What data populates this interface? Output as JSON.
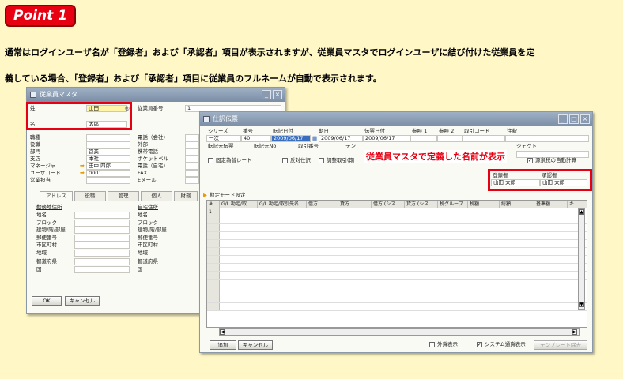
{
  "point_label": "Point 1",
  "description": {
    "line1": "通常はログインユーザ名が「登録者」および「承認者」項目が表示されますが、従業員マスタでログインユーザに結び付けた従業員を定",
    "line2": "義している場合、「登録者」および「承認者」項目に従業員のフルネームが自動で表示されます。"
  },
  "employee_window": {
    "title": "従業員マスタ",
    "last_name_label": "姓",
    "last_name_value": "山田",
    "first_name_label": "名",
    "first_name_value": "太郎",
    "employee_no_label": "従業員番号",
    "employee_no_value": "1",
    "left_labels": [
      "職種",
      "役職",
      "部門",
      "支店",
      "マネージャ",
      "ユーザコード",
      "営業担当"
    ],
    "left_values": [
      "",
      "",
      "営業",
      "本社",
      "田中 四郎",
      "0001",
      ""
    ],
    "right_labels": [
      "電話（会社）",
      "外部",
      "携帯電話",
      "ポケットベル",
      "電話（自宅）",
      "FAX",
      "Eメール"
    ],
    "tabs": [
      "アドレス",
      "役職",
      "管理",
      "個人",
      "財務"
    ],
    "work_address_label": "勤務地住所",
    "home_address_label": "自宅住所",
    "address_fields": [
      "地名",
      "ブロック",
      "建物/階/部屋",
      "郵便番号",
      "市区町村",
      "地域",
      "都道府県",
      "国"
    ],
    "ok_label": "OK",
    "cancel_label": "キャンセル"
  },
  "transfer_window": {
    "title": "仕訳伝票",
    "header_labels": [
      "シリーズ",
      "番号",
      "転記日付",
      "期日",
      "伝票日付",
      "参照 1",
      "参照 2",
      "取引コード",
      "注釈"
    ],
    "series_value": "一次",
    "number_value": "40",
    "posting_date": "2009/06/17",
    "due_date": "2009/06/17",
    "doc_date": "2009/06/17",
    "row2_labels": [
      "転記元伝票",
      "転記元No",
      "取引番号",
      "テン"
    ],
    "project_label": "ジェクト",
    "fixed_rate_label": "固定為替レート",
    "reverse_label": "反対仕訳",
    "adjust_label": "調整取引(期",
    "auto_tax_label": "源泉税の自動計算",
    "registrant_label": "登録者",
    "approver_label": "承認者",
    "registrant_value": "山田 太郎",
    "approver_value": "山田 太郎",
    "table_label": "勘定モード設定",
    "columns": [
      "#",
      "G/L 勘定/取...",
      "G/L 勘定/取引先名",
      "借方",
      "貸方",
      "借方 (シス...",
      "貸方 (シス...",
      "税グループ",
      "税額",
      "総額",
      "基準額",
      "キ"
    ],
    "first_row_no": "1",
    "add_label": "追加",
    "cancel_label": "キャンセル",
    "fc_display_label": "外貨表示",
    "sys_currency_label": "システム通貨表示",
    "template_label": "テンプレート除去"
  },
  "callout": "従業員マスタで定義した名前が表示"
}
